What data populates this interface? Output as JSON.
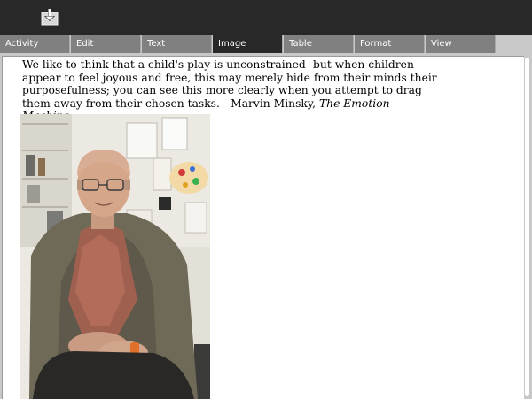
{
  "toolbar": {
    "save_icon": "download-icon"
  },
  "tabs": [
    {
      "label": "Activity",
      "active": false
    },
    {
      "label": "Edit",
      "active": false
    },
    {
      "label": "Text",
      "active": false
    },
    {
      "label": "Image",
      "active": true
    },
    {
      "label": "Table",
      "active": false
    },
    {
      "label": "Format",
      "active": false
    },
    {
      "label": "View",
      "active": false
    }
  ],
  "document": {
    "quote_text": "We like to think that a child's play is unconstrained--but when children appear to feel joyous and free, this may merely hide from their minds their purposefulness; you can see this more clearly when you attempt to drag them away from their chosen tasks. --Marvin Minsky, ",
    "book_title": "The Emotion Machine",
    "photo_icon": "portrait-photo"
  },
  "colors": {
    "toolbar_bg": "#282828",
    "tab_bg": "#808080",
    "tab_active_bg": "#282828",
    "frame_bg": "#c8c8c8",
    "canvas_bg": "#ffffff"
  }
}
